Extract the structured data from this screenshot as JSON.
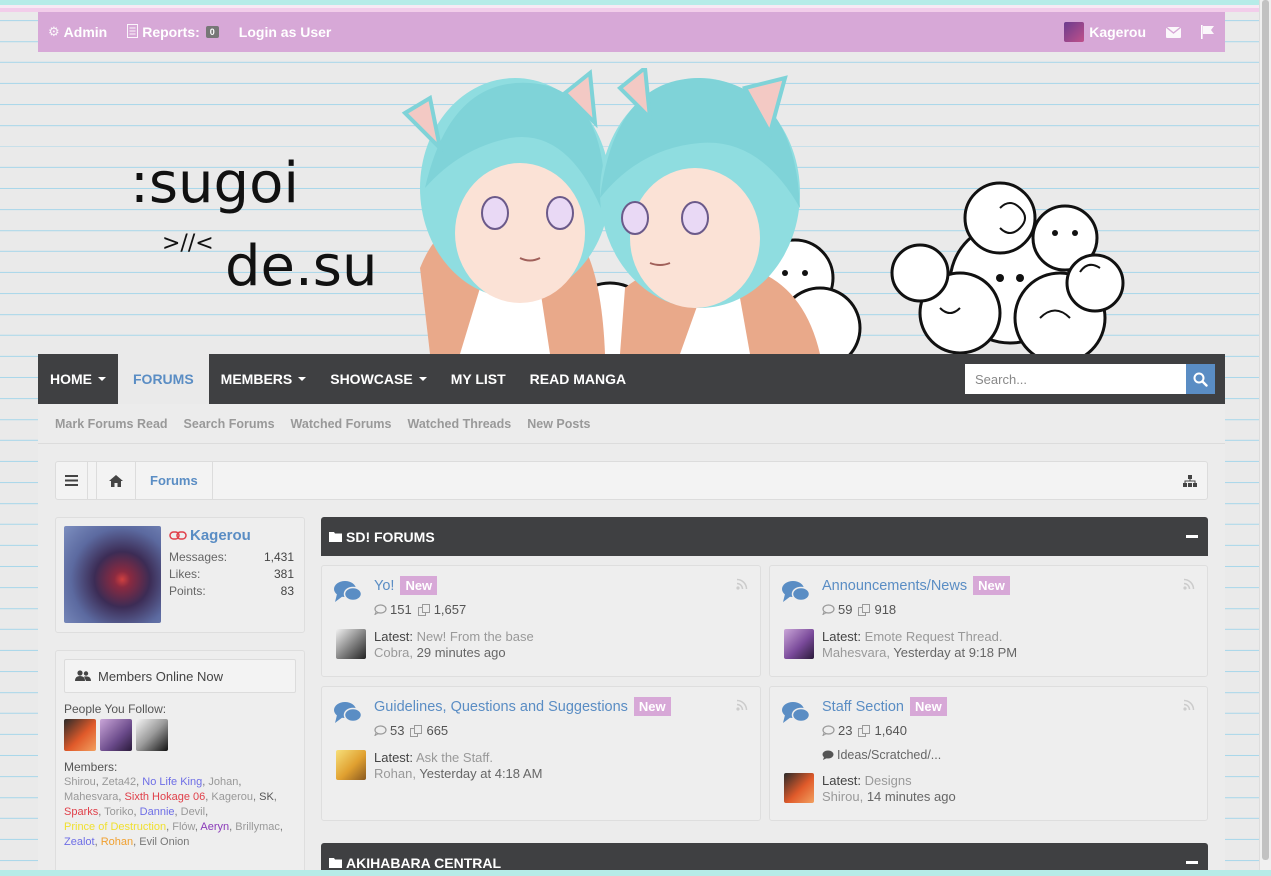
{
  "adminbar": {
    "admin_label": "Admin",
    "reports_label": "Reports:",
    "reports_count": "0",
    "login_as_label": "Login as User",
    "username": "Kagerou"
  },
  "logo": {
    "line1": ":sugoi",
    "line2": ">//<",
    "line3": "de.su"
  },
  "nav": {
    "tabs": [
      "HOME",
      "FORUMS",
      "MEMBERS",
      "SHOWCASE",
      "MY LIST",
      "READ MANGA"
    ],
    "selected": "FORUMS",
    "search_placeholder": "Search..."
  },
  "subnav": [
    "Mark Forums Read",
    "Search Forums",
    "Watched Forums",
    "Watched Threads",
    "New Posts"
  ],
  "breadcrumb": {
    "current": "Forums"
  },
  "visitor": {
    "name": "Kagerou",
    "stats": [
      {
        "label": "Messages:",
        "value": "1,431"
      },
      {
        "label": "Likes:",
        "value": "381"
      },
      {
        "label": "Points:",
        "value": "83"
      }
    ]
  },
  "online": {
    "title": "Members Online Now",
    "follow_label": "People You Follow:",
    "members_label": "Members:",
    "members": [
      {
        "name": "Shirou",
        "color": "#999999"
      },
      {
        "name": "Zeta42",
        "color": "#999999"
      },
      {
        "name": "No Life King",
        "color": "#6e6ee6"
      },
      {
        "name": "Johan",
        "color": "#999999"
      },
      {
        "name": "Mahesvara",
        "color": "#999999"
      },
      {
        "name": "Sixth Hokage 06",
        "color": "#e0404a"
      },
      {
        "name": "Kagerou",
        "color": "#999999"
      },
      {
        "name": "SK",
        "color": "#555555"
      },
      {
        "name": "Sparks",
        "color": "#e0404a"
      },
      {
        "name": "Toriko",
        "color": "#999999"
      },
      {
        "name": "Dannie",
        "color": "#6e6ee6"
      },
      {
        "name": "Devil",
        "color": "#999999"
      },
      {
        "name": "Prince of Destruction",
        "color": "#f0e030"
      },
      {
        "name": "Flów",
        "color": "#999999"
      },
      {
        "name": "Aeryn",
        "color": "#8a3ab9"
      },
      {
        "name": "Brillymac",
        "color": "#999999"
      },
      {
        "name": "Zealot",
        "color": "#6e6ee6"
      },
      {
        "name": "Rohan",
        "color": "#f0a030"
      },
      {
        "name": "Evil Onion",
        "color": "#777777"
      }
    ]
  },
  "categories": [
    {
      "title": "SD! FORUMS",
      "nodes": [
        {
          "title": "Yo!",
          "badge": "New",
          "discussions": "151",
          "messages": "1,657",
          "latest_label": "Latest:",
          "latest_title": "New! From the base",
          "latest_user": "Cobra",
          "latest_date": "29 minutes ago",
          "subforum": ""
        },
        {
          "title": "Announcements/News",
          "badge": "New",
          "discussions": "59",
          "messages": "918",
          "latest_label": "Latest:",
          "latest_title": "Emote Request Thread.",
          "latest_user": "Mahesvara",
          "latest_date": "Yesterday at 9:18 PM",
          "subforum": ""
        },
        {
          "title": "Guidelines, Questions and Suggestions",
          "badge": "New",
          "discussions": "53",
          "messages": "665",
          "latest_label": "Latest:",
          "latest_title": "Ask the Staff.",
          "latest_user": "Rohan",
          "latest_date": "Yesterday at 4:18 AM",
          "subforum": ""
        },
        {
          "title": "Staff Section",
          "badge": "New",
          "discussions": "23",
          "messages": "1,640",
          "latest_label": "Latest:",
          "latest_title": "Designs",
          "latest_user": "Shirou",
          "latest_date": "14 minutes ago",
          "subforum": "Ideas/Scratched/..."
        }
      ]
    },
    {
      "title": "AKIHABARA CENTRAL",
      "nodes": []
    }
  ],
  "colors": {
    "accent": "#5a8dc4",
    "badge": "#d7a8d7",
    "dark_bar": "#3f4042",
    "admin_bar": "#d7a8d7"
  }
}
